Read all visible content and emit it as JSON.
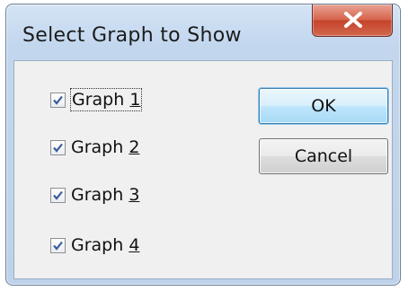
{
  "window": {
    "title": "Select Graph to Show"
  },
  "checkboxes": [
    {
      "label_pre": "Graph ",
      "label_acc": "1",
      "checked": true,
      "focused": true
    },
    {
      "label_pre": "Graph ",
      "label_acc": "2",
      "checked": true,
      "focused": false
    },
    {
      "label_pre": "Graph ",
      "label_acc": "3",
      "checked": true,
      "focused": false
    },
    {
      "label_pre": "Graph ",
      "label_acc": "4",
      "checked": true,
      "focused": false
    }
  ],
  "buttons": {
    "ok_label": "OK",
    "cancel_label": "Cancel"
  },
  "icons": {
    "close": "close-x-icon",
    "check": "checkmark-icon"
  },
  "colors": {
    "close_button": "#c94a33",
    "default_button_border": "#3c7fb1",
    "checkmark": "#3a5d9c"
  }
}
